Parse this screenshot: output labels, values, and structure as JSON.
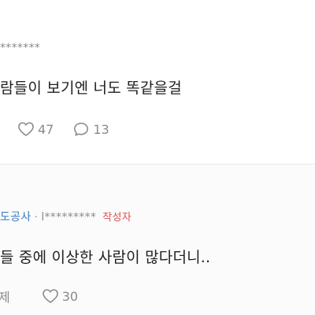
{
  "posts": [
    {
      "author_masked": "*******",
      "body": "람들이 보기엔 너도 똑같을걸",
      "likes": "47",
      "comments": "13"
    },
    {
      "company": "도공사",
      "separator": "·",
      "author_masked": "l*********",
      "author_tag": "작성자",
      "body": "들 중에 이상한 사람이 많다더니..",
      "cut_action_text": "제",
      "likes": "30"
    }
  ],
  "icons": {
    "like": "heart-outline-icon",
    "comment": "speech-bubble-outline-icon"
  },
  "colors": {
    "company": "#3b78c4",
    "author_tag": "#e0504a",
    "muted": "#8a8a8a",
    "text": "#1f1f1f",
    "divider": "#ececec"
  }
}
